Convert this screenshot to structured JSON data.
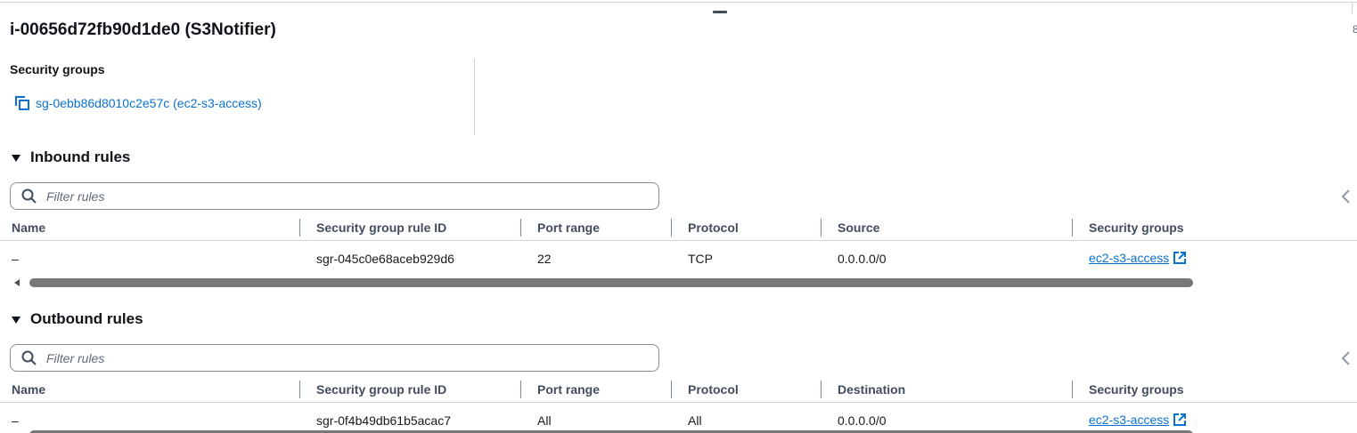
{
  "instance": {
    "title": "i-00656d72fb90d1de0 (S3Notifier)"
  },
  "security_groups_panel": {
    "label": "Security groups",
    "link_text": "sg-0ebb86d8010c2e57c (ec2-s3-access)"
  },
  "inbound": {
    "title": "Inbound rules",
    "filter_placeholder": "Filter rules",
    "columns": [
      "Name",
      "Security group rule ID",
      "Port range",
      "Protocol",
      "Source",
      "Security groups"
    ],
    "rows": [
      {
        "name": "–",
        "rule_id": "sgr-045c0e68aceb929d6",
        "port_range": "22",
        "protocol": "TCP",
        "source": "0.0.0.0/0",
        "security_group": "ec2-s3-access"
      }
    ]
  },
  "outbound": {
    "title": "Outbound rules",
    "filter_placeholder": "Filter rules",
    "columns": [
      "Name",
      "Security group rule ID",
      "Port range",
      "Protocol",
      "Destination",
      "Security groups"
    ],
    "rows": [
      {
        "name": "–",
        "rule_id": "sgr-0f4b49db61b5acac7",
        "port_range": "All",
        "protocol": "All",
        "destination": "0.0.0.0/0",
        "security_group": "ec2-s3-access"
      }
    ]
  },
  "edge_mark": "8",
  "icons": {
    "copy": "copy-icon",
    "caret": "caret-down-icon",
    "search": "search-icon",
    "external": "external-link-icon",
    "pager": "chevron-left-icon"
  },
  "colors": {
    "link": "#0972d3",
    "heading": "#0f141a",
    "column_header": "#414d5c"
  }
}
